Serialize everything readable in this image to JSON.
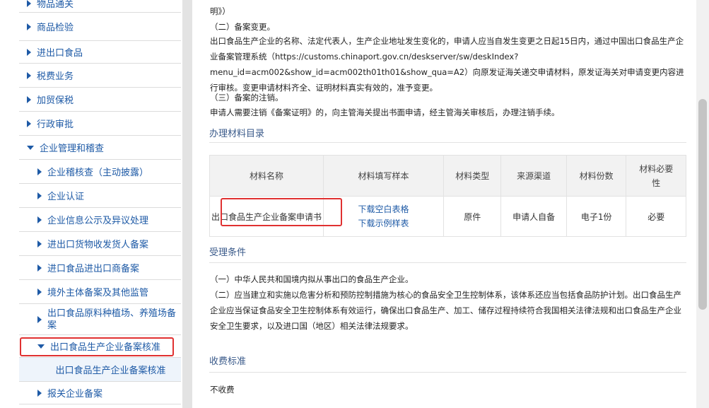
{
  "sidebar": {
    "items": [
      {
        "label": "物品通关",
        "arrow": "right",
        "level": 1
      },
      {
        "label": "商品检验",
        "arrow": "right",
        "level": 1
      },
      {
        "label": "进出口食品",
        "arrow": "right",
        "level": 1
      },
      {
        "label": "税费业务",
        "arrow": "right",
        "level": 1
      },
      {
        "label": "加贸保税",
        "arrow": "right",
        "level": 1
      },
      {
        "label": "行政审批",
        "arrow": "right",
        "level": 1
      },
      {
        "label": "企业管理和稽查",
        "arrow": "down",
        "level": 1
      },
      {
        "label": "企业稽核查（主动披露）",
        "arrow": "right",
        "level": 2
      },
      {
        "label": "企业认证",
        "arrow": "right",
        "level": 2
      },
      {
        "label": "企业信息公示及异议处理",
        "arrow": "right",
        "level": 2
      },
      {
        "label": "进出口货物收发货人备案",
        "arrow": "right",
        "level": 2
      },
      {
        "label": "进口食品进出口商备案",
        "arrow": "right",
        "level": 2
      },
      {
        "label": "境外主体备案及其他监管",
        "arrow": "right",
        "level": 2
      },
      {
        "label": "出口食品原料种植场、养殖场备案",
        "arrow": "right",
        "level": 2
      },
      {
        "label": "出口食品生产企业备案核准",
        "arrow": "down",
        "level": 2
      },
      {
        "label": "出口食品生产企业备案核准",
        "arrow": "none",
        "level": 3
      },
      {
        "label": "报关企业备案",
        "arrow": "right",
        "level": 2
      }
    ]
  },
  "content": {
    "top_fragment": "明》）",
    "change_heading": "（二）备案变更。",
    "change_p1": "出口食品生产企业的名称、法定代表人，生产企业地址发生变化的，申请人应当自发生变更之日起15日内，通过中国出口食品生产企业备案管理系统（https://customs.chinaport.gov.cn/deskserver/sw/deskIndex?",
    "change_p2": "menu_id=acm002&show_id=acm002th01th01&show_qua=A2）向原发证海关递交申请材料，原发证海关对申请变更内容进行审核。变更申请材料齐全、证明材料真实有效的，准予变更。",
    "cancel_heading": "（三）备案的注销。",
    "cancel_p": "申请人需要注销《备案证明》的，向主管海关提出书面申请，经主管海关审核后，办理注销手续。",
    "materials_title": "办理材料目录",
    "table": {
      "headers": [
        "材料名称",
        "材料填写样本",
        "材料类型",
        "来源渠道",
        "材料份数",
        "材料必要性"
      ],
      "row": {
        "name": "出口食品生产企业备案申请书",
        "link_blank": "下载空白表格",
        "link_sample": "下载示例样表",
        "type": "原件",
        "source": "申请人自备",
        "copies": "电子1份",
        "necessity": "必要"
      }
    },
    "conditions_title": "受理条件",
    "cond_1": "（一）中华人民共和国境内拟从事出口的食品生产企业。",
    "cond_2": "（二）应当建立和实施以危害分析和预防控制措施为核心的食品安全卫生控制体系，该体系还应当包括食品防护计划。出口食品生产企业应当保证食品安全卫生控制体系有效运行，确保出口食品生产、加工、储存过程持续符合我国相关法律法规和出口食品生产企业安全卫生要求，以及进口国（地区）相关法律法规要求。",
    "fee_title": "收费标准",
    "fee_text": "不收费"
  },
  "colors": {
    "link": "#1e5aa6",
    "highlight_box": "#e03131"
  }
}
